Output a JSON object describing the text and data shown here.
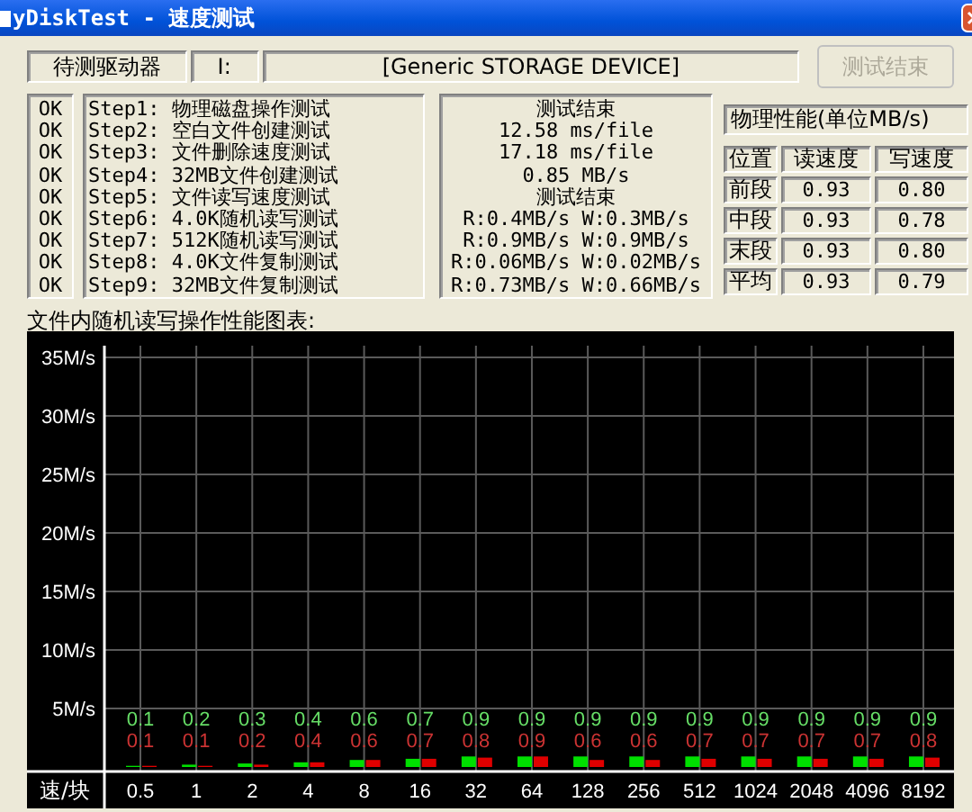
{
  "window": {
    "title": "yDiskTest - 速度测试"
  },
  "drive": {
    "label": "待测驱动器",
    "letter": "I:",
    "name": "[Generic STORAGE DEVICE]"
  },
  "button": {
    "label": "测试结束",
    "disabled": true
  },
  "steps": [
    {
      "status": "OK",
      "name": "Step1: 物理磁盘操作测试",
      "result": "测试结束"
    },
    {
      "status": "OK",
      "name": "Step2: 空白文件创建测试",
      "result": "12.58 ms/file"
    },
    {
      "status": "OK",
      "name": "Step3: 文件删除速度测试",
      "result": "17.18 ms/file"
    },
    {
      "status": "OK",
      "name": "Step4: 32MB文件创建测试",
      "result": "0.85 MB/s"
    },
    {
      "status": "OK",
      "name": "Step5: 文件读写速度测试",
      "result": "测试结束"
    },
    {
      "status": "OK",
      "name": "Step6: 4.0K随机读写测试",
      "result": "R:0.4MB/s W:0.3MB/s"
    },
    {
      "status": "OK",
      "name": "Step7: 512K随机读写测试",
      "result": "R:0.9MB/s W:0.9MB/s"
    },
    {
      "status": "OK",
      "name": "Step8: 4.0K文件复制测试",
      "result": "R:0.06MB/s W:0.02MB/s"
    },
    {
      "status": "OK",
      "name": "Step9: 32MB文件复制测试",
      "result": "R:0.73MB/s W:0.66MB/s"
    }
  ],
  "performance": {
    "title": "物理性能(单位MB/s)",
    "columns": [
      "位置",
      "读速度",
      "写速度"
    ],
    "rows": [
      [
        "前段",
        "0.93",
        "0.80"
      ],
      [
        "中段",
        "0.93",
        "0.78"
      ],
      [
        "末段",
        "0.93",
        "0.80"
      ],
      [
        "平均",
        "0.93",
        "0.79"
      ]
    ]
  },
  "chart": {
    "title": "文件内随机读写操作性能图表:",
    "chart_data": {
      "type": "bar",
      "xlabel": "速/块",
      "categories": [
        "0.5",
        "1",
        "2",
        "4",
        "8",
        "16",
        "32",
        "64",
        "128",
        "256",
        "512",
        "1024",
        "2048",
        "4096",
        "8192"
      ],
      "series": [
        {
          "color": "#00e000",
          "values": [
            0.1,
            0.2,
            0.3,
            0.4,
            0.6,
            0.7,
            0.9,
            0.9,
            0.9,
            0.9,
            0.9,
            0.9,
            0.9,
            0.9,
            0.9
          ]
        },
        {
          "color": "#e00000",
          "values": [
            0.1,
            0.1,
            0.2,
            0.4,
            0.6,
            0.7,
            0.8,
            0.9,
            0.6,
            0.6,
            0.7,
            0.7,
            0.7,
            0.7,
            0.8
          ]
        }
      ],
      "yticks": [
        {
          "value": 5,
          "label": "5M/s"
        },
        {
          "value": 10,
          "label": "10M/s"
        },
        {
          "value": 15,
          "label": "15M/s"
        },
        {
          "value": 20,
          "label": "20M/s"
        },
        {
          "value": 25,
          "label": "25M/s"
        },
        {
          "value": 30,
          "label": "30M/s"
        },
        {
          "value": 35,
          "label": "35M/s"
        }
      ],
      "ylim": [
        0,
        36
      ],
      "grid": true,
      "data_labels": true
    }
  }
}
